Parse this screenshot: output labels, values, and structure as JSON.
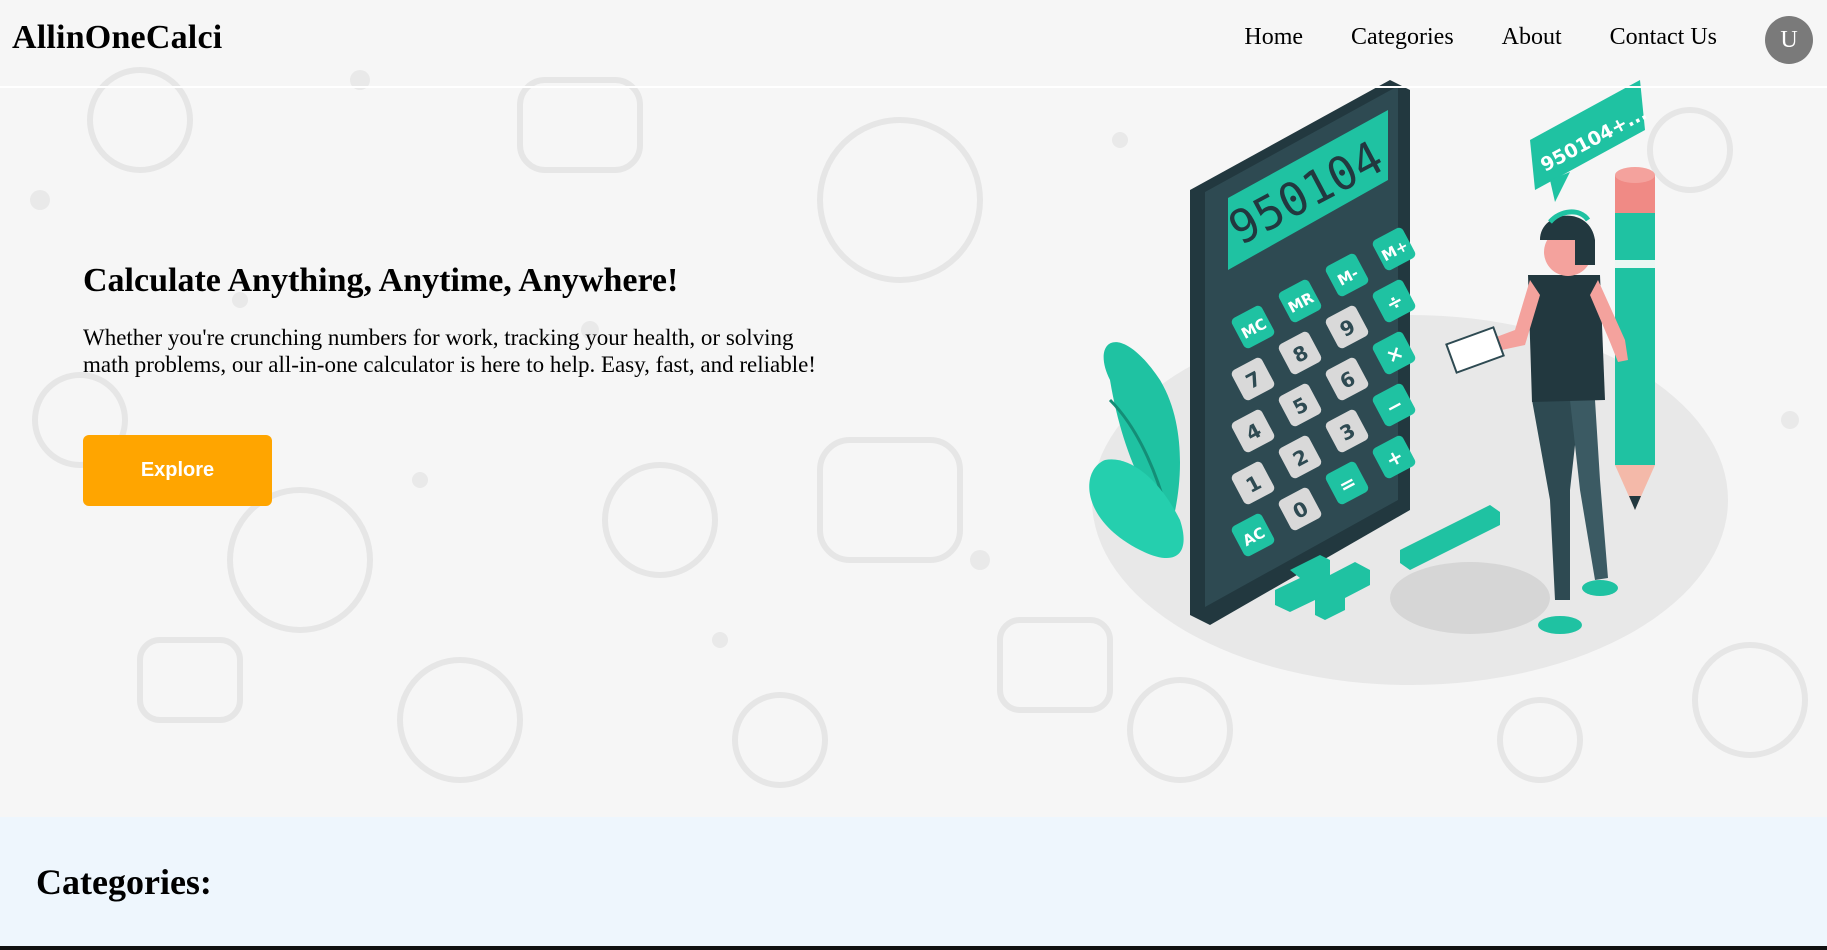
{
  "header": {
    "brand": "AllinOneCalci",
    "nav": [
      {
        "label": "Home"
      },
      {
        "label": "Categories"
      },
      {
        "label": "About"
      },
      {
        "label": "Contact Us"
      }
    ],
    "avatar_initial": "U"
  },
  "hero": {
    "title": "Calculate Anything, Anytime, Anywhere!",
    "description": "Whether you're crunching numbers for work, tracking your health, or solving math problems, our all-in-one calculator is here to help. Easy, fast, and reliable!",
    "button_label": "Explore"
  },
  "illustration": {
    "display_value": "950104",
    "bubble_text": "950104+...",
    "keys": {
      "memory": [
        "MC",
        "MR",
        "M-",
        "M+"
      ],
      "row1": [
        "7",
        "8",
        "9",
        "÷"
      ],
      "row2": [
        "4",
        "5",
        "6",
        "×"
      ],
      "row3": [
        "1",
        "2",
        "3",
        "−"
      ],
      "row4": [
        "AC",
        "0",
        "=",
        "+"
      ]
    }
  },
  "categories": {
    "title": "Categories:"
  },
  "colors": {
    "accent_button": "#ffa500",
    "teal": "#1fc2a2",
    "dark_slate": "#2e4a52",
    "categories_bg": "#eef6fd"
  }
}
